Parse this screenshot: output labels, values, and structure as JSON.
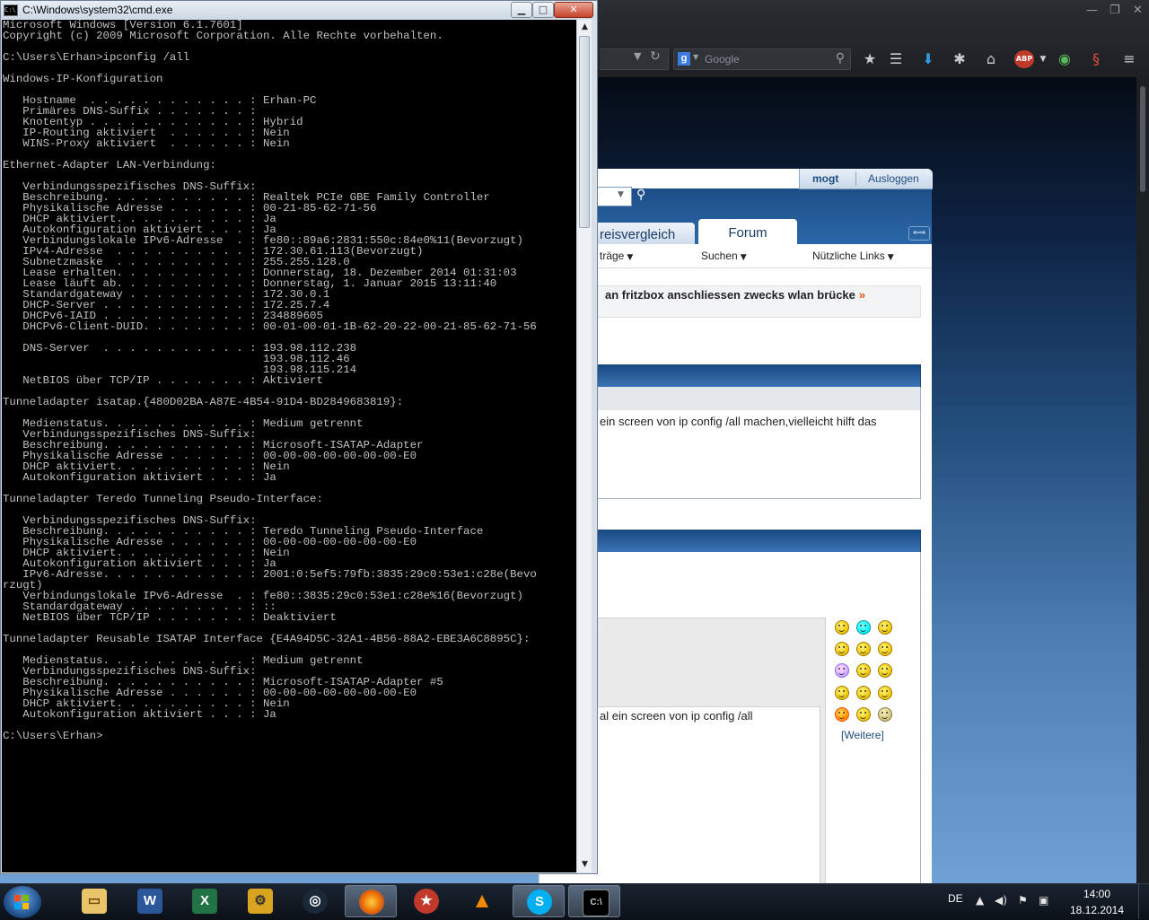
{
  "browser": {
    "search_placeholder": "Google",
    "toolbar_icons": [
      "bookmark-star-icon",
      "reading-list-icon",
      "download-icon",
      "pocket-icon",
      "home-icon",
      "adblock-plus-icon",
      "sync-icon",
      "extension-icon",
      "menu-icon"
    ]
  },
  "forum": {
    "user_name": "mogt",
    "logout_label": "Ausloggen",
    "tab_preisvergleich": "reisvergleich",
    "tab_forum": "Forum",
    "nav": {
      "beitraege": "träge",
      "suchen": "Suchen",
      "links": "Nützliche Links"
    },
    "thread_title": "an fritzbox anschliessen zwecks wlan brücke",
    "thread_arrow": "»",
    "post1_text": "ein screen von ip config /all machen,vielleicht hilft das",
    "editor_text": "al ein screen von ip config /all",
    "more_smileys": "[Weitere]"
  },
  "cmd": {
    "title": "C:\\Windows\\system32\\cmd.exe",
    "output": "Microsoft Windows [Version 6.1.7601]\nCopyright (c) 2009 Microsoft Corporation. Alle Rechte vorbehalten.\n\nC:\\Users\\Erhan>ipconfig /all\n\nWindows-IP-Konfiguration\n\n   Hostname  . . . . . . . . . . . . : Erhan-PC\n   Primäres DNS-Suffix . . . . . . . :\n   Knotentyp . . . . . . . . . . . . : Hybrid\n   IP-Routing aktiviert  . . . . . . : Nein\n   WINS-Proxy aktiviert  . . . . . . : Nein\n\nEthernet-Adapter LAN-Verbindung:\n\n   Verbindungsspezifisches DNS-Suffix:\n   Beschreibung. . . . . . . . . . . : Realtek PCIe GBE Family Controller\n   Physikalische Adresse . . . . . . : 00-21-85-62-71-56\n   DHCP aktiviert. . . . . . . . . . : Ja\n   Autokonfiguration aktiviert . . . : Ja\n   Verbindungslokale IPv6-Adresse  . : fe80::89a6:2831:550c:84e0%11(Bevorzugt)\n   IPv4-Adresse  . . . . . . . . . . : 172.30.61.113(Bevorzugt)\n   Subnetzmaske  . . . . . . . . . . : 255.255.128.0\n   Lease erhalten. . . . . . . . . . : Donnerstag, 18. Dezember 2014 01:31:03\n   Lease läuft ab. . . . . . . . . . : Donnerstag, 1. Januar 2015 13:11:40\n   Standardgateway . . . . . . . . . : 172.30.0.1\n   DHCP-Server . . . . . . . . . . . : 172.25.7.4\n   DHCPv6-IAID . . . . . . . . . . . : 234889605\n   DHCPv6-Client-DUID. . . . . . . . : 00-01-00-01-1B-62-20-22-00-21-85-62-71-56\n\n   DNS-Server  . . . . . . . . . . . : 193.98.112.238\n                                       193.98.112.46\n                                       193.98.115.214\n   NetBIOS über TCP/IP . . . . . . . : Aktiviert\n\nTunneladapter isatap.{480D02BA-A87E-4B54-91D4-BD2849683819}:\n\n   Medienstatus. . . . . . . . . . . : Medium getrennt\n   Verbindungsspezifisches DNS-Suffix:\n   Beschreibung. . . . . . . . . . . : Microsoft-ISATAP-Adapter\n   Physikalische Adresse . . . . . . : 00-00-00-00-00-00-00-E0\n   DHCP aktiviert. . . . . . . . . . : Nein\n   Autokonfiguration aktiviert . . . : Ja\n\nTunneladapter Teredo Tunneling Pseudo-Interface:\n\n   Verbindungsspezifisches DNS-Suffix:\n   Beschreibung. . . . . . . . . . . : Teredo Tunneling Pseudo-Interface\n   Physikalische Adresse . . . . . . : 00-00-00-00-00-00-00-E0\n   DHCP aktiviert. . . . . . . . . . : Nein\n   Autokonfiguration aktiviert . . . : Ja\n   IPv6-Adresse. . . . . . . . . . . : 2001:0:5ef5:79fb:3835:29c0:53e1:c28e(Bevo\nrzugt)\n   Verbindungslokale IPv6-Adresse  . : fe80::3835:29c0:53e1:c28e%16(Bevorzugt)\n   Standardgateway . . . . . . . . . : ::\n   NetBIOS über TCP/IP . . . . . . . : Deaktiviert\n\nTunneladapter Reusable ISATAP Interface {E4A94D5C-32A1-4B56-88A2-EBE3A6C8895C}:\n\n   Medienstatus. . . . . . . . . . . : Medium getrennt\n   Verbindungsspezifisches DNS-Suffix:\n   Beschreibung. . . . . . . . . . . : Microsoft-ISATAP-Adapter #5\n   Physikalische Adresse . . . . . . : 00-00-00-00-00-00-00-E0\n   DHCP aktiviert. . . . . . . . . . : Nein\n   Autokonfiguration aktiviert . . . : Ja\n\nC:\\Users\\Erhan>"
  },
  "taskbar": {
    "apps": [
      "windows-explorer",
      "microsoft-word",
      "microsoft-excel",
      "control-panel",
      "steam",
      "firefox",
      "pokerstars",
      "vlc",
      "skype",
      "cmd"
    ],
    "language": "DE",
    "time": "14:00",
    "date": "18.12.2014"
  }
}
